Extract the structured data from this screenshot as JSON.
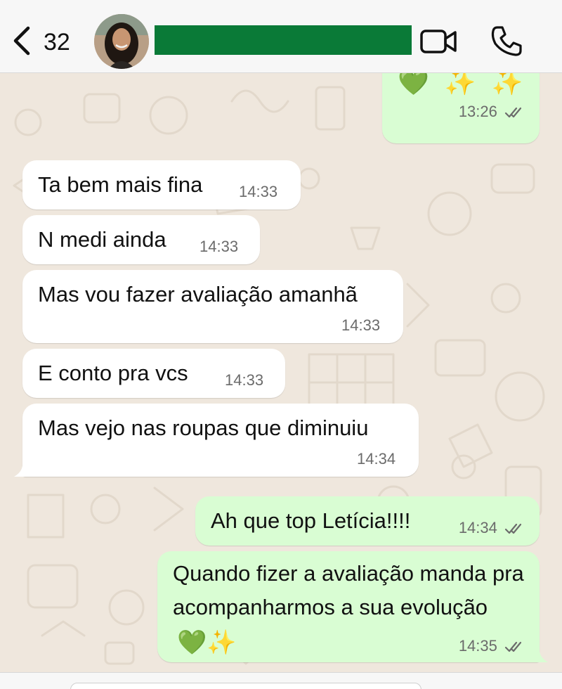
{
  "header": {
    "unread_count": "32",
    "contact_name_redacted": true
  },
  "messages": [
    {
      "direction": "out",
      "text": "",
      "emoji": "💚 ✨ ✨",
      "time": "13:26",
      "status": "read"
    },
    {
      "direction": "in",
      "text": "Ta bem mais fina",
      "time": "14:33"
    },
    {
      "direction": "in",
      "text": "N medi ainda",
      "time": "14:33"
    },
    {
      "direction": "in",
      "text": "Mas vou fazer avaliação amanhã",
      "time": "14:33"
    },
    {
      "direction": "in",
      "text": "E conto pra vcs",
      "time": "14:33"
    },
    {
      "direction": "in",
      "text": "Mas vejo nas roupas que diminuiu",
      "time": "14:34"
    },
    {
      "direction": "out",
      "text": "Ah que top Letícia!!!!",
      "time": "14:34",
      "status": "read"
    },
    {
      "direction": "out",
      "text": "Quando fizer a avaliação manda pra acompanharmos a sua evolução",
      "emoji": "💚✨",
      "time": "14:35",
      "status": "read"
    }
  ],
  "colors": {
    "wallpaper": "#efe7dd",
    "incoming_bubble": "#ffffff",
    "outgoing_bubble": "#d9fdd3",
    "redaction_bar": "#0a7a37",
    "ticks": "#6b6b6b"
  },
  "icons": {
    "back": "chevron-left-icon",
    "video": "video-camera-icon",
    "call": "phone-icon",
    "read_status": "double-check-icon",
    "heart": "green-heart-emoji",
    "sparkles": "sparkles-emoji"
  }
}
